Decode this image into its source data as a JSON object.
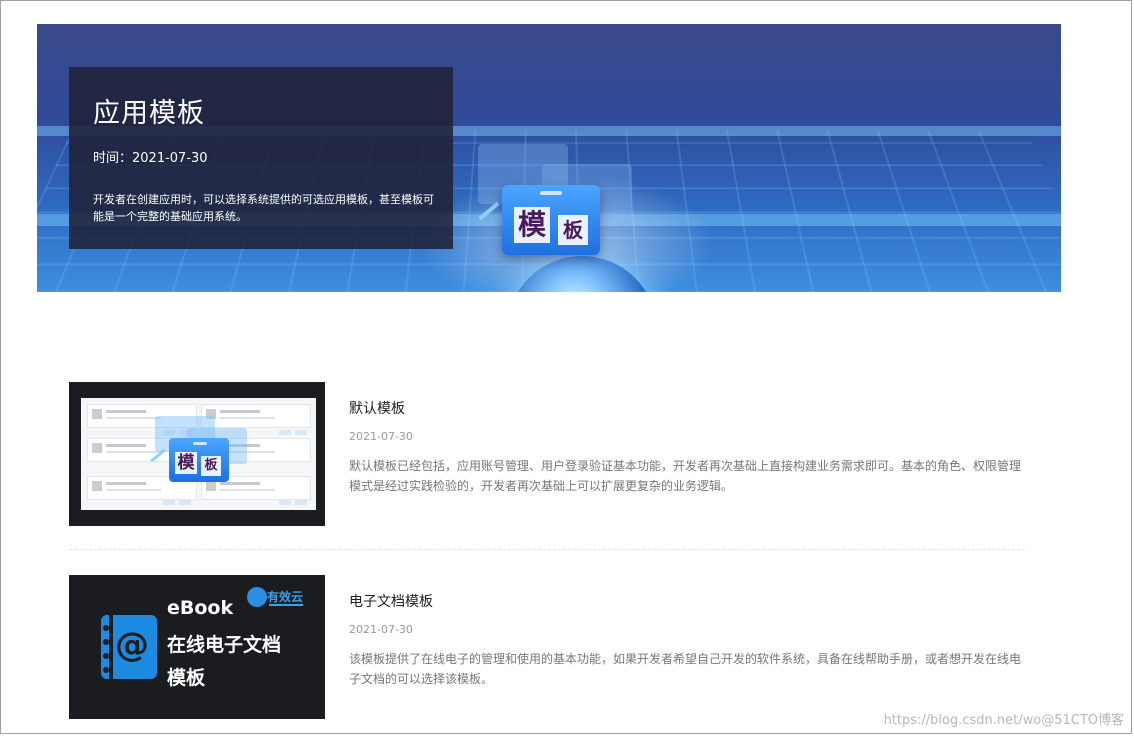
{
  "banner": {
    "title": "应用模板",
    "date": "时间：2021-07-30",
    "description": "开发者在创建应用时，可以选择系统提供的可选应用模板，甚至模板可能是一个完整的基础应用系统。",
    "icon_chars": [
      "模",
      "板"
    ]
  },
  "templates": [
    {
      "title": "默认模板",
      "date": "2021-07-30",
      "description": "默认模板已经包括，应用账号管理、用户登录验证基本功能，开发者再次基础上直接构建业务需求即可。基本的角色、权限管理模式是经过实践检验的，开发者再次基础上可以扩展更复杂的业务逻辑。",
      "thumb_chars": [
        "模",
        "板"
      ]
    },
    {
      "title": "电子文档模板",
      "date": "2021-07-30",
      "description": "该模板提供了在线电子的管理和使用的基本功能，如果开发者希望自己开发的软件系统，具备在线帮助手册，或者想开发在线电子文档的可以选择该模板。",
      "thumb_lines": [
        "eBook",
        "在线电子文档",
        "模板"
      ],
      "thumb_logo": "有效云",
      "thumb_at": "@"
    }
  ],
  "watermark": "https://blog.csdn.net/wo@51CTO博客",
  "colors": {
    "banner_bg": "#2f4a98",
    "overlay_bg": "#1e2034",
    "accent_blue": "#1d8be0"
  }
}
